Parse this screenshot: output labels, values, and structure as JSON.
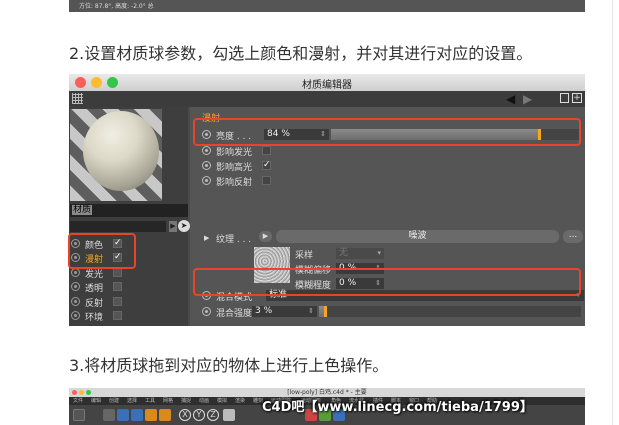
{
  "top_strip": {
    "text": "方位: 87.8°, 高度: -2.0° 总"
  },
  "step2": {
    "text": "2.设置材质球参数，勾选上颜色和漫射，并对其进行对应的设置。"
  },
  "step3": {
    "text": "3.将材质球拖到对应的物体上进行上色操作。"
  },
  "editor": {
    "title": "材质编辑器",
    "material_name": "材质",
    "channels": [
      {
        "label": "颜色",
        "checked": true,
        "check": "✓"
      },
      {
        "label": "漫射",
        "checked": true,
        "check": "✓",
        "active": true
      },
      {
        "label": "发光",
        "checked": false,
        "check": ""
      },
      {
        "label": "透明",
        "checked": false,
        "check": ""
      },
      {
        "label": "反射",
        "checked": false,
        "check": ""
      },
      {
        "label": "环境",
        "checked": false,
        "check": ""
      }
    ],
    "section_title": "漫射",
    "brightness": {
      "label": "亮度 . . .",
      "value": "84 %",
      "fraction": 0.84
    },
    "affect_luminance": {
      "label": "影响发光",
      "check": ""
    },
    "affect_specular": {
      "label": "影响高光",
      "check": "✓"
    },
    "affect_reflection": {
      "label": "影响反射",
      "check": ""
    },
    "texture": {
      "label": "纹理 . . .",
      "shader": "噪波",
      "more": "..."
    },
    "sampling": {
      "label": "采样",
      "value": "无"
    },
    "blur_offset": {
      "label": "模糊偏移",
      "value": "0 %"
    },
    "blur_scale": {
      "label": "模糊程度",
      "value": "0 %"
    },
    "mix_mode": {
      "label": "混合模式",
      "value": "标准"
    },
    "mix_strength": {
      "label": "混合强度",
      "value": "3 %",
      "fraction": 0.03
    }
  },
  "app": {
    "title": "[low-poly] 白鸡.c4d * - 主要",
    "menu": [
      "文件",
      "编辑",
      "创建",
      "选择",
      "工具",
      "网格",
      "捕捉",
      "动画",
      "模拟",
      "渲染",
      "雕刻",
      "运动跟踪",
      "运动图形",
      "角色",
      "流水线",
      "插件",
      "脚本",
      "窗口",
      "帮助"
    ],
    "axis_labels": [
      "X",
      "Y",
      "Z"
    ]
  },
  "watermark": "C4D吧【www.linecg.com/tieba/1799】",
  "colors": {
    "accent": "#f5a623",
    "highlight": "#e8442a"
  }
}
